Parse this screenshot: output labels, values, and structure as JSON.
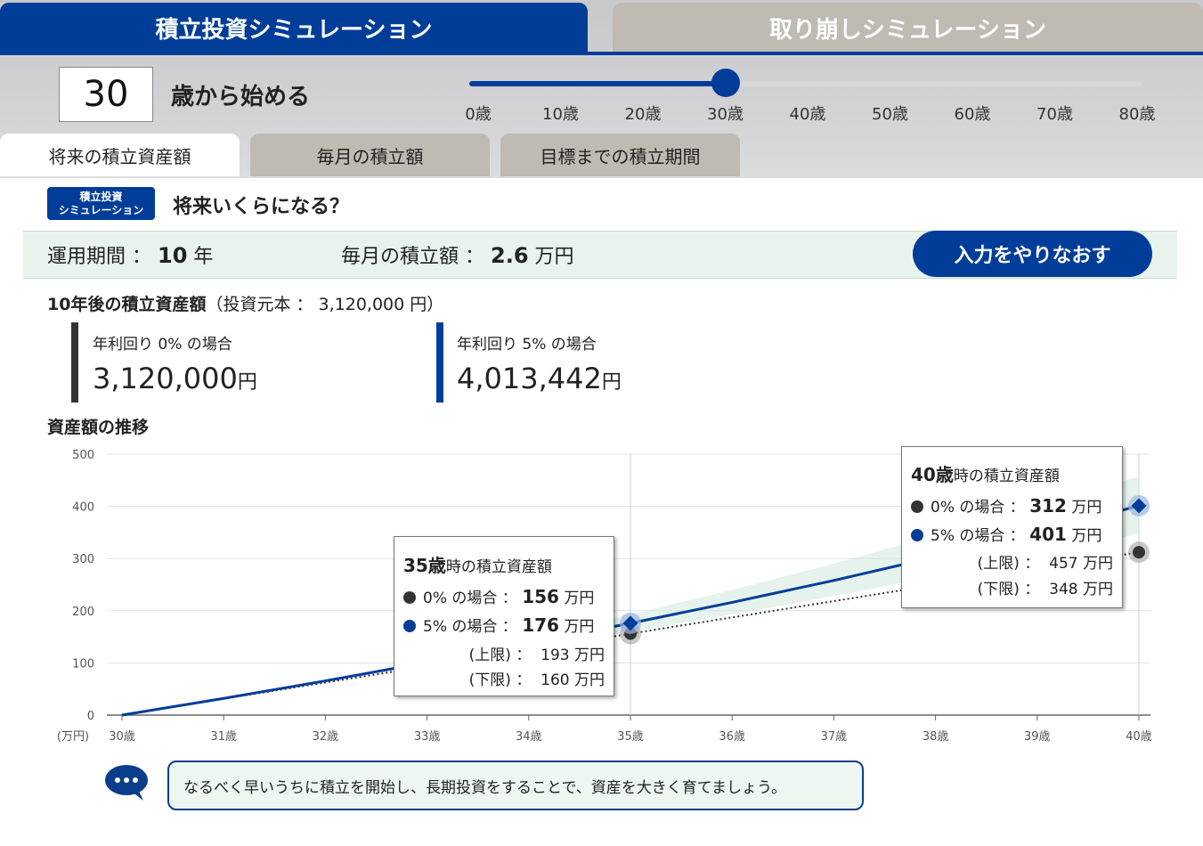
{
  "main_tabs": [
    {
      "label": "積立投資シミュレーション",
      "active": true
    },
    {
      "label": "取り崩しシミュレーション",
      "active": false
    }
  ],
  "age": {
    "value": "30",
    "label": "歳から始める"
  },
  "slider": {
    "min": 0,
    "max": 80,
    "value": 30,
    "ticks": [
      "0歳",
      "10歳",
      "20歳",
      "30歳",
      "40歳",
      "50歳",
      "60歳",
      "70歳",
      "80歳"
    ]
  },
  "sub_tabs": [
    {
      "label": "将来の積立資産額",
      "active": true
    },
    {
      "label": "毎月の積立額",
      "active": false
    },
    {
      "label": "目標までの積立期間",
      "active": false
    }
  ],
  "badge": {
    "line1": "積立投資",
    "line2": "シミュレーション"
  },
  "heading": "将来いくらになる？",
  "summary": {
    "period_label": "運用期間 ：",
    "period_value": "10",
    "period_unit": "年",
    "monthly_label": "毎月の積立額 ：",
    "monthly_value": "2.6",
    "monthly_unit": "万円",
    "redo_button": "入力をやりなおす"
  },
  "result": {
    "title_bold": "10年後の積立資産額",
    "title_rest": "（投資元本 ： 3,120,000 円）",
    "items": [
      {
        "label": "年利回り 0% の場合",
        "value": "3,120,000",
        "unit": "円",
        "color": "#333333"
      },
      {
        "label": "年利回り 5% の場合",
        "value": "4,013,442",
        "unit": "円",
        "color": "#003d99"
      }
    ]
  },
  "chart_title": "資産額の推移",
  "chart_data": {
    "type": "line",
    "x": [
      "30歳",
      "31歳",
      "32歳",
      "33歳",
      "34歳",
      "35歳",
      "36歳",
      "37歳",
      "38歳",
      "39歳",
      "40歳"
    ],
    "ylim": [
      0,
      500
    ],
    "yticks": [
      "0",
      "100",
      "200",
      "300",
      "400",
      "500"
    ],
    "yunit": "(万円)",
    "series": [
      {
        "key": "0%",
        "color": "#333333",
        "style": "dotted",
        "values": [
          0,
          31.2,
          62.4,
          93.6,
          124.8,
          156,
          187.2,
          218.4,
          249.6,
          280.8,
          312
        ]
      },
      {
        "key": "5%",
        "color": "#003d99",
        "style": "solid",
        "values": [
          0,
          32,
          65.6,
          100.9,
          138,
          176,
          216,
          258,
          303,
          350,
          401
        ]
      }
    ],
    "band": {
      "color": "#cfe9dc",
      "upper": [
        0,
        32.5,
        67,
        105,
        145,
        193,
        240,
        290,
        345,
        400,
        457
      ],
      "lower": [
        0,
        31.5,
        64,
        96.5,
        130,
        160,
        193,
        228,
        266,
        305,
        348
      ]
    },
    "markers_at": [
      "35歳",
      "40歳"
    ]
  },
  "tooltips": [
    {
      "age": "35歳",
      "title_suffix": "時の積立資産額",
      "r0_label": "0% の場合 ：",
      "r0_value": "156",
      "r5_label": "5% の場合 ：",
      "r5_value": "176",
      "up_label": "(上限) ：",
      "up_value": "193",
      "low_label": "(下限) ：",
      "low_value": "160",
      "unit": "万円"
    },
    {
      "age": "40歳",
      "title_suffix": "時の積立資産額",
      "r0_label": "0% の場合 ：",
      "r0_value": "312",
      "r5_label": "5% の場合 ：",
      "r5_value": "401",
      "up_label": "(上限) ：",
      "up_value": "457",
      "low_label": "(下限) ：",
      "low_value": "348",
      "unit": "万円"
    }
  ],
  "note": "なるべく早いうちに積立を開始し、長期投資をすることで、資産を大きく育てましょう。"
}
